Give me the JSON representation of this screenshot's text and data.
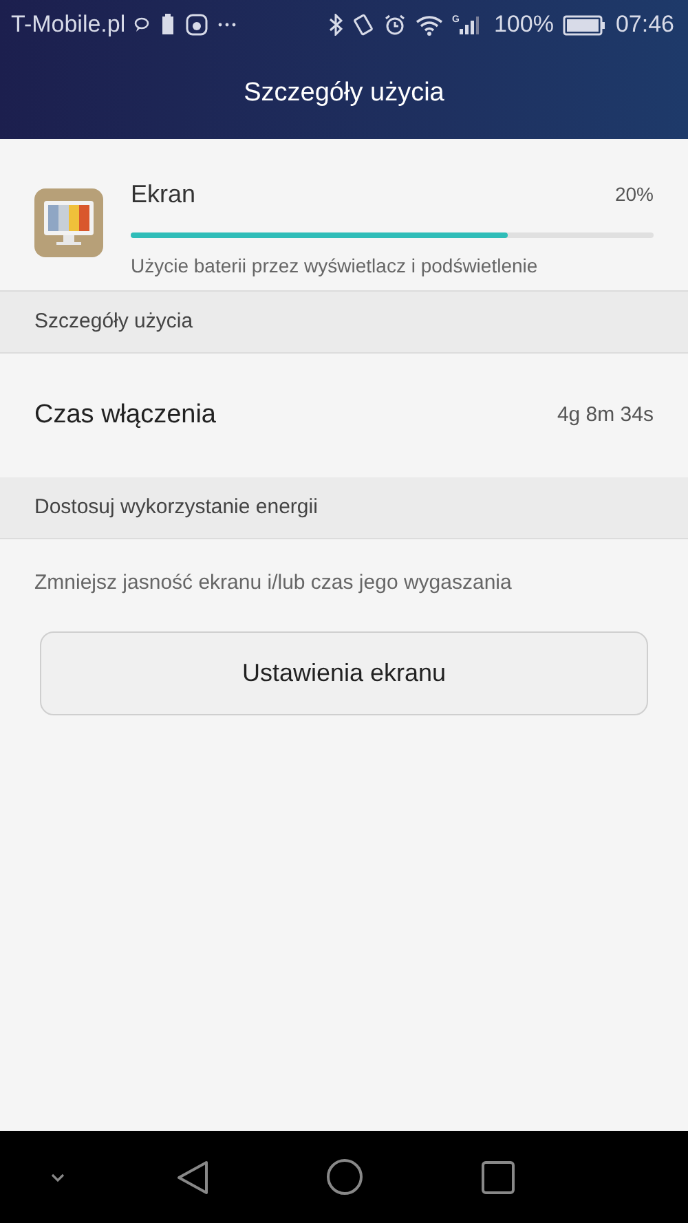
{
  "status_bar": {
    "carrier": "T-Mobile.pl",
    "battery": "100%",
    "time": "07:46",
    "network_type": "G"
  },
  "title": "Szczegóły użycia",
  "usage": {
    "name": "Ekran",
    "percent": "20%",
    "level": 0.72,
    "description": "Użycie baterii przez wyświetlacz i podświetlenie"
  },
  "sections": [
    {
      "header": "Szczegóły użycia",
      "rows": [
        {
          "kind": "stat",
          "label": "Czas włączenia",
          "value": "4g 8m 34s"
        }
      ]
    },
    {
      "header": "Dostosuj wykorzystanie energii",
      "rows": [
        {
          "kind": "hint",
          "label": "Zmniejsz jasność ekranu i/lub czas jego wygaszania"
        },
        {
          "kind": "button",
          "label": "Ustawienia ekranu"
        }
      ]
    }
  ]
}
